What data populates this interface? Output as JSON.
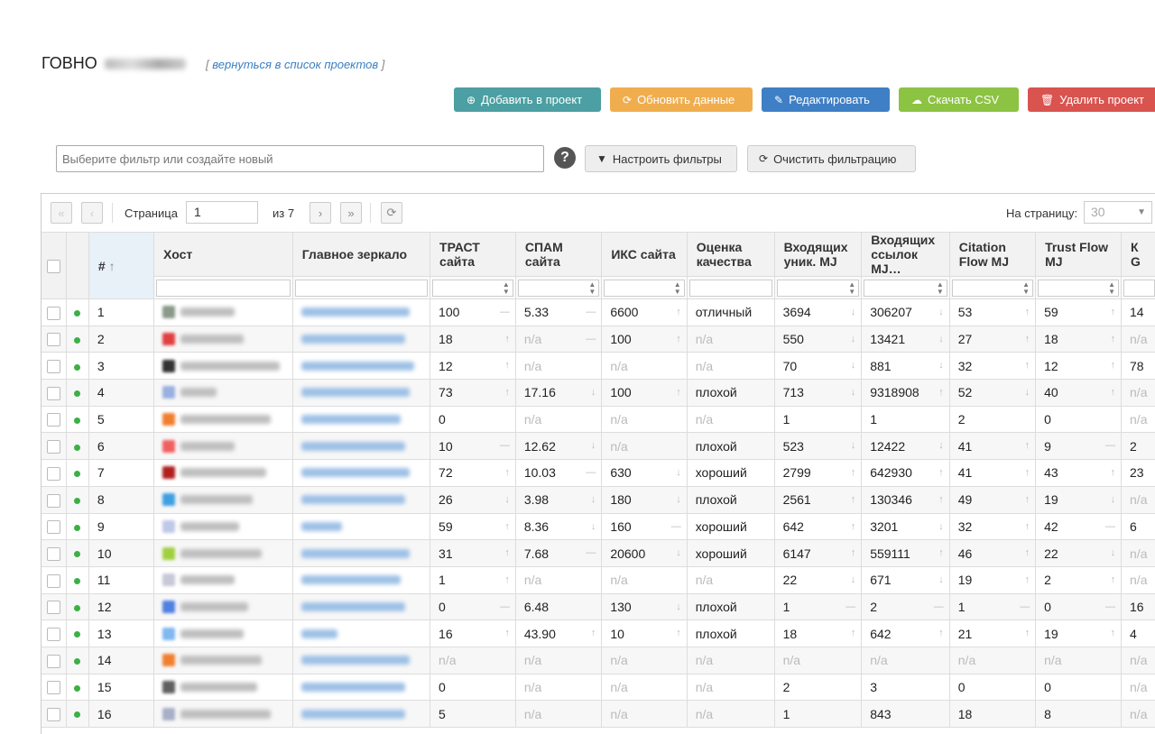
{
  "project": {
    "title": "ГОВНО",
    "back_link": "вернуться в список проектов"
  },
  "actions": {
    "add": "Добавить в проект",
    "refresh": "Обновить данные",
    "edit": "Редактировать",
    "csv": "Скачать CSV",
    "delete": "Удалить проект"
  },
  "filter": {
    "placeholder": "Выберите фильтр или создайте новый",
    "help": "?",
    "configure": "Настроить фильтры",
    "clear": "Очистить фильтрацию"
  },
  "pager": {
    "page_label": "Страница",
    "page": "1",
    "of": "из 7",
    "per_page_label": "На страницу:",
    "per_page": "30"
  },
  "columns": {
    "num": "#",
    "host": "Хост",
    "mirror": "Главное зеркало",
    "trust": "ТРАСТ сайта",
    "spam": "СПАМ сайта",
    "iks": "ИКС сайта",
    "quality": "Оценка качества",
    "in_uniq": "Входящих уник. MJ",
    "in_links": "Входящих ссылок MJ…",
    "cf": "Citation Flow MJ",
    "tf": "Trust Flow MJ",
    "last": "К G"
  },
  "colors": {
    "good": "#2a9d2a",
    "bad": "#ee3333",
    "mid": "#f0a000",
    "na": "#bbbbbb"
  },
  "rows": [
    {
      "n": "1",
      "fav": "#8a9a8a",
      "trust": "100",
      "trust_c": "good",
      "trust_t": "—",
      "spam": "5.33",
      "spam_c": "good",
      "spam_t": "—",
      "iks": "6600",
      "iks_t": "↑",
      "q": "отличный",
      "q_c": "good",
      "iu": "3694",
      "iu_t": "↓",
      "il": "306207",
      "il_t": "↓",
      "cf": "53",
      "cf_t": "↑",
      "tf": "59",
      "tf_t": "↑",
      "k": "14"
    },
    {
      "n": "2",
      "fav": "#e04040",
      "trust": "18",
      "trust_c": "bad",
      "trust_t": "↑",
      "spam": "n/a",
      "spam_c": "na",
      "spam_t": "—",
      "iks": "100",
      "iks_t": "↑",
      "q": "n/a",
      "q_c": "na",
      "iu": "550",
      "iu_t": "↓",
      "il": "13421",
      "il_t": "↓",
      "cf": "27",
      "cf_t": "↑",
      "tf": "18",
      "tf_t": "↑",
      "k": "n/a"
    },
    {
      "n": "3",
      "fav": "#333333",
      "trust": "12",
      "trust_c": "bad",
      "trust_t": "↑",
      "spam": "n/a",
      "spam_c": "na",
      "spam_t": "",
      "iks": "n/a",
      "iks_t": "",
      "q": "n/a",
      "q_c": "na",
      "iu": "70",
      "iu_t": "↓",
      "il": "881",
      "il_t": "↓",
      "cf": "32",
      "cf_t": "↑",
      "tf": "12",
      "tf_t": "↑",
      "k": "78"
    },
    {
      "n": "4",
      "fav": "#9ab0e0",
      "trust": "73",
      "trust_c": "good",
      "trust_t": "↑",
      "spam": "17.16",
      "spam_c": "bad",
      "spam_t": "↓",
      "iks": "100",
      "iks_t": "↑",
      "q": "плохой",
      "q_c": "bad",
      "iu": "713",
      "iu_t": "↓",
      "il": "9318908",
      "il_t": "↑",
      "cf": "52",
      "cf_t": "↓",
      "tf": "40",
      "tf_t": "↑",
      "k": "n/a"
    },
    {
      "n": "5",
      "fav": "#f08030",
      "trust": "0",
      "trust_c": "bad",
      "trust_t": "",
      "spam": "n/a",
      "spam_c": "na",
      "spam_t": "",
      "iks": "n/a",
      "iks_t": "",
      "q": "n/a",
      "q_c": "na",
      "iu": "1",
      "iu_t": "",
      "il": "1",
      "il_t": "",
      "cf": "2",
      "cf_t": "",
      "tf": "0",
      "tf_t": "",
      "k": "n/a"
    },
    {
      "n": "6",
      "fav": "#f06060",
      "trust": "10",
      "trust_c": "bad",
      "trust_t": "—",
      "spam": "12.62",
      "spam_c": "bad",
      "spam_t": "↓",
      "iks": "n/a",
      "iks_t": "",
      "q": "плохой",
      "q_c": "bad",
      "iu": "523",
      "iu_t": "↓",
      "il": "12422",
      "il_t": "↓",
      "cf": "41",
      "cf_t": "↑",
      "tf": "9",
      "tf_t": "—",
      "k": "2"
    },
    {
      "n": "7",
      "fav": "#b02020",
      "trust": "72",
      "trust_c": "good",
      "trust_t": "↑",
      "spam": "10.03",
      "spam_c": "mid",
      "spam_t": "—",
      "iks": "630",
      "iks_t": "↓",
      "q": "хороший",
      "q_c": "mid",
      "iu": "2799",
      "iu_t": "↑",
      "il": "642930",
      "il_t": "↑",
      "cf": "41",
      "cf_t": "↑",
      "tf": "43",
      "tf_t": "↑",
      "k": "23"
    },
    {
      "n": "8",
      "fav": "#40a0e0",
      "trust": "26",
      "trust_c": "bad",
      "trust_t": "↓",
      "spam": "3.98",
      "spam_c": "good",
      "spam_t": "↓",
      "iks": "180",
      "iks_t": "↓",
      "q": "плохой",
      "q_c": "bad",
      "iu": "2561",
      "iu_t": "↑",
      "il": "130346",
      "il_t": "↑",
      "cf": "49",
      "cf_t": "↑",
      "tf": "19",
      "tf_t": "↓",
      "k": "n/a"
    },
    {
      "n": "9",
      "fav": "#c0c8e8",
      "trust": "59",
      "trust_c": "good",
      "trust_t": "↑",
      "spam": "8.36",
      "spam_c": "mid",
      "spam_t": "↓",
      "iks": "160",
      "iks_t": "—",
      "q": "хороший",
      "q_c": "mid",
      "iu": "642",
      "iu_t": "↑",
      "il": "3201",
      "il_t": "↓",
      "cf": "32",
      "cf_t": "↑",
      "tf": "42",
      "tf_t": "—",
      "k": "6"
    },
    {
      "n": "10",
      "fav": "#a0d040",
      "trust": "31",
      "trust_c": "mid",
      "trust_t": "↑",
      "spam": "7.68",
      "spam_c": "mid",
      "spam_t": "—",
      "iks": "20600",
      "iks_t": "↓",
      "q": "хороший",
      "q_c": "mid",
      "iu": "6147",
      "iu_t": "↑",
      "il": "559111",
      "il_t": "↑",
      "cf": "46",
      "cf_t": "↑",
      "tf": "22",
      "tf_t": "↓",
      "k": "n/a"
    },
    {
      "n": "11",
      "fav": "#c8c8d8",
      "trust": "1",
      "trust_c": "bad",
      "trust_t": "↑",
      "spam": "n/a",
      "spam_c": "na",
      "spam_t": "",
      "iks": "n/a",
      "iks_t": "",
      "q": "n/a",
      "q_c": "na",
      "iu": "22",
      "iu_t": "↓",
      "il": "671",
      "il_t": "↓",
      "cf": "19",
      "cf_t": "↑",
      "tf": "2",
      "tf_t": "↑",
      "k": "n/a"
    },
    {
      "n": "12",
      "fav": "#5080e0",
      "trust": "0",
      "trust_c": "bad",
      "trust_t": "—",
      "spam": "6.48",
      "spam_c": "good",
      "spam_t": "",
      "iks": "130",
      "iks_t": "↓",
      "q": "плохой",
      "q_c": "bad",
      "iu": "1",
      "iu_t": "—",
      "il": "2",
      "il_t": "—",
      "cf": "1",
      "cf_t": "—",
      "tf": "0",
      "tf_t": "—",
      "k": "16"
    },
    {
      "n": "13",
      "fav": "#80b8f0",
      "trust": "16",
      "trust_c": "bad",
      "trust_t": "↑",
      "spam": "43.90",
      "spam_c": "bad",
      "spam_t": "↑",
      "iks": "10",
      "iks_t": "↑",
      "q": "плохой",
      "q_c": "bad",
      "iu": "18",
      "iu_t": "↑",
      "il": "642",
      "il_t": "↑",
      "cf": "21",
      "cf_t": "↑",
      "tf": "19",
      "tf_t": "↑",
      "k": "4"
    },
    {
      "n": "14",
      "fav": "#f08030",
      "trust": "n/a",
      "trust_c": "na",
      "trust_t": "",
      "spam": "n/a",
      "spam_c": "na",
      "spam_t": "",
      "iks": "n/a",
      "iks_t": "",
      "q": "n/a",
      "q_c": "na",
      "iu": "n/a",
      "iu_t": "",
      "il": "n/a",
      "il_t": "",
      "cf": "n/a",
      "cf_t": "",
      "tf": "n/a",
      "tf_t": "",
      "k": "n/a"
    },
    {
      "n": "15",
      "fav": "#606060",
      "trust": "0",
      "trust_c": "bad",
      "trust_t": "",
      "spam": "n/a",
      "spam_c": "na",
      "spam_t": "",
      "iks": "n/a",
      "iks_t": "",
      "q": "n/a",
      "q_c": "na",
      "iu": "2",
      "iu_t": "",
      "il": "3",
      "il_t": "",
      "cf": "0",
      "cf_t": "",
      "tf": "0",
      "tf_t": "",
      "k": "n/a"
    },
    {
      "n": "16",
      "fav": "#a8b0c8",
      "trust": "5",
      "trust_c": "bad",
      "trust_t": "",
      "spam": "n/a",
      "spam_c": "na",
      "spam_t": "",
      "iks": "n/a",
      "iks_t": "",
      "q": "n/a",
      "q_c": "na",
      "iu": "1",
      "iu_t": "",
      "il": "843",
      "il_t": "",
      "cf": "18",
      "cf_t": "",
      "tf": "8",
      "tf_t": "",
      "k": "n/a"
    }
  ]
}
